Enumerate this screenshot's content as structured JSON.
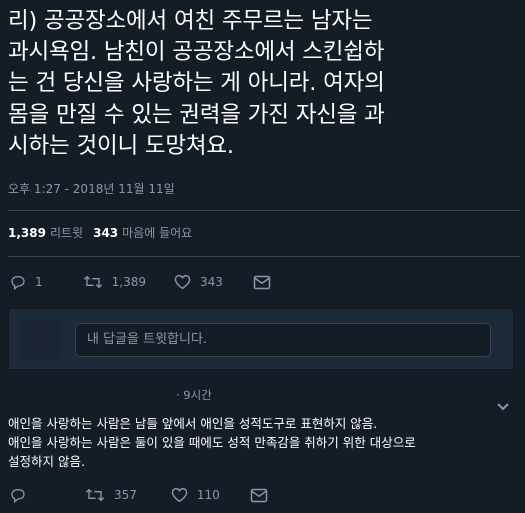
{
  "tweet": {
    "text_lines": [
      "리) 공공장소에서 여친 주무르는 남자는",
      "과시욕임. 남친이 공공장소에서 스킨쉽하",
      "는 건 당신을 사랑하는 게 아니라. 여자의",
      "몸을 만질 수 있는 권력을 가진 자신을 과",
      "시하는 것이니 도망쳐요."
    ],
    "timestamp": "오후 1:27 - 2018년 11월 11일",
    "retweet_count": "1,389",
    "retweet_label": "리트윗",
    "like_count": "343",
    "like_label": "마음에 들어요",
    "actions": {
      "reply_count": "1",
      "retweet_count": "1,389",
      "like_count": "343"
    }
  },
  "reply_box": {
    "placeholder": "내 답글을 트윗합니다."
  },
  "reply": {
    "meta": "· 9시간",
    "text_lines": [
      "애인을 사랑하는 사람은 남들 앞에서 애인을 성적도구로 표현하지 않음.",
      "애인을 사랑하는 사람은 둘이 있을 때에도 성적 만족감을 취하기 위한 대상으로",
      "설정하지 않음."
    ],
    "actions": {
      "reply_count": "",
      "retweet_count": "357",
      "like_count": "110"
    }
  },
  "colors": {
    "background": "#141d26",
    "text": "#ffffff",
    "muted": "#8899a6",
    "divider": "#38444d"
  },
  "icons": [
    "reply-icon",
    "retweet-icon",
    "like-icon",
    "dm-icon",
    "chevron-down-icon"
  ]
}
